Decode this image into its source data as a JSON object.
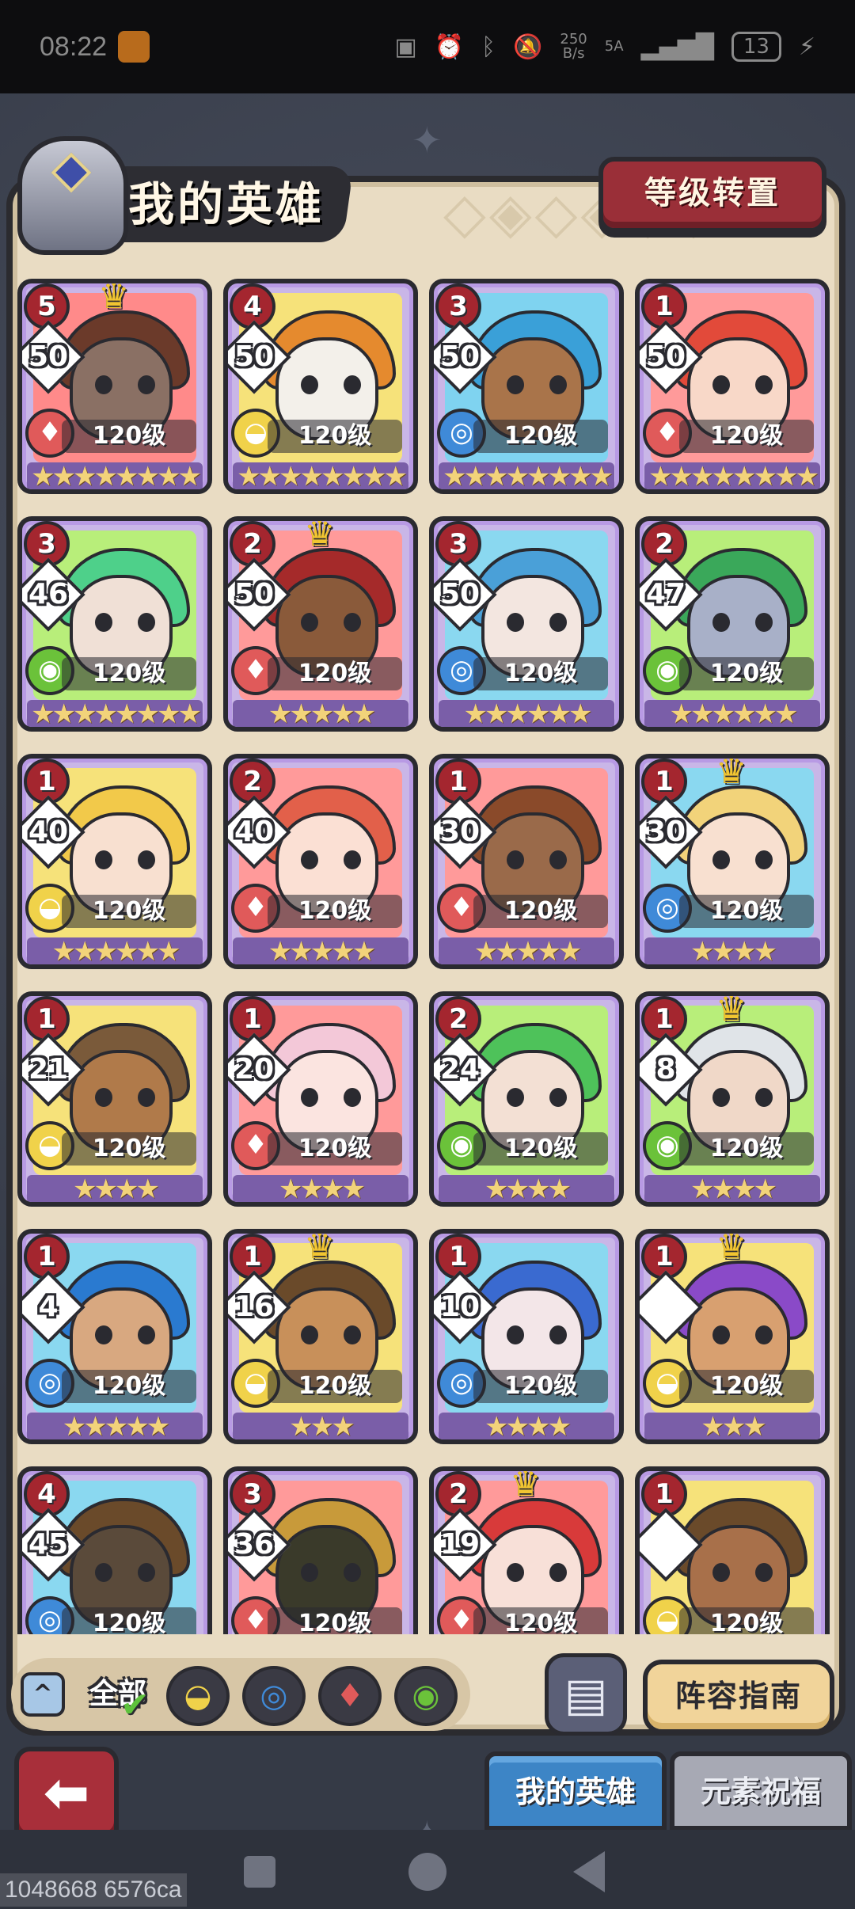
{
  "status_bar": {
    "time": "08:22",
    "speed_value": "250",
    "speed_unit": "B/s",
    "signal": "5A",
    "battery": "13"
  },
  "header": {
    "title": "我的英雄",
    "level_transfer_label": "等级转置"
  },
  "elements": {
    "earth": {
      "glyph": "◒",
      "color": "#f0d24a"
    },
    "water": {
      "glyph": "◎",
      "color": "#3f8ad8"
    },
    "fire": {
      "glyph": "♦",
      "color": "#e05a5a"
    },
    "wind": {
      "glyph": "◉",
      "color": "#6bc23a"
    }
  },
  "heroes": [
    {
      "stars_badge": "5",
      "crown": true,
      "rank": "50",
      "element": "fire",
      "level": "120级",
      "stars": "★★★★★★★★",
      "bg": "#ff8a8a",
      "hair": "#6b3a2a",
      "skin": "#8a7064"
    },
    {
      "stars_badge": "4",
      "crown": false,
      "rank": "50",
      "element": "earth",
      "level": "120级",
      "stars": "★★★★★★★★",
      "bg": "#f6e27a",
      "hair": "#e58a2e",
      "skin": "#f3f0ea"
    },
    {
      "stars_badge": "3",
      "crown": false,
      "rank": "50",
      "element": "water",
      "level": "120级",
      "stars": "★★★★★★★★",
      "bg": "#7fd3f0",
      "hair": "#3aa0d8",
      "skin": "#a9744a"
    },
    {
      "stars_badge": "1",
      "crown": false,
      "rank": "50",
      "element": "fire",
      "level": "120级",
      "stars": "★★★★★★★★",
      "bg": "#ff9a9a",
      "hair": "#e24a3a",
      "skin": "#f8d8c8"
    },
    {
      "stars_badge": "3",
      "crown": false,
      "rank": "46",
      "element": "wind",
      "level": "120级",
      "stars": "★★★★★★★★",
      "bg": "#b8ee7a",
      "hair": "#4ed08a",
      "skin": "#f0e0d6"
    },
    {
      "stars_badge": "2",
      "crown": true,
      "rank": "50",
      "element": "fire",
      "level": "120级",
      "stars": "★★★★★",
      "bg": "#ff9a9a",
      "hair": "#a52a2a",
      "skin": "#8a5a3a"
    },
    {
      "stars_badge": "3",
      "crown": false,
      "rank": "50",
      "element": "water",
      "level": "120级",
      "stars": "★★★★★★",
      "bg": "#8ad8f0",
      "hair": "#4aa0d8",
      "skin": "#f3e6e0"
    },
    {
      "stars_badge": "2",
      "crown": false,
      "rank": "47",
      "element": "wind",
      "level": "120级",
      "stars": "★★★★★★",
      "bg": "#b8ee7a",
      "hair": "#3aa85a",
      "skin": "#a8b0c8"
    },
    {
      "stars_badge": "1",
      "crown": false,
      "rank": "40",
      "element": "earth",
      "level": "120级",
      "stars": "★★★★★★",
      "bg": "#f6e27a",
      "hair": "#f2c94a",
      "skin": "#f8e0d0"
    },
    {
      "stars_badge": "2",
      "crown": false,
      "rank": "40",
      "element": "fire",
      "level": "120级",
      "stars": "★★★★★",
      "bg": "#ff9a9a",
      "hair": "#e2604a",
      "skin": "#fbe0d4"
    },
    {
      "stars_badge": "1",
      "crown": false,
      "rank": "30",
      "element": "fire",
      "level": "120级",
      "stars": "★★★★★",
      "bg": "#ff9a9a",
      "hair": "#8a4a2a",
      "skin": "#9a6a4a"
    },
    {
      "stars_badge": "1",
      "crown": true,
      "rank": "30",
      "element": "water",
      "level": "120级",
      "stars": "★★★★",
      "bg": "#8ad8f0",
      "hair": "#f2d37a",
      "skin": "#f8e0d0"
    },
    {
      "stars_badge": "1",
      "crown": false,
      "rank": "21",
      "element": "earth",
      "level": "120级",
      "stars": "★★★★",
      "bg": "#f6e27a",
      "hair": "#7a5a3a",
      "skin": "#b07a4a"
    },
    {
      "stars_badge": "1",
      "crown": false,
      "rank": "20",
      "element": "fire",
      "level": "120级",
      "stars": "★★★★",
      "bg": "#ff9a9a",
      "hair": "#f3c8d8",
      "skin": "#fbe4e0"
    },
    {
      "stars_badge": "2",
      "crown": false,
      "rank": "24",
      "element": "wind",
      "level": "120级",
      "stars": "★★★★",
      "bg": "#b8ee7a",
      "hair": "#4ec25a",
      "skin": "#f3e0d4"
    },
    {
      "stars_badge": "1",
      "crown": true,
      "rank": "8",
      "element": "wind",
      "level": "120级",
      "stars": "★★★★",
      "bg": "#b8ee7a",
      "hair": "#e0e4e8",
      "skin": "#f0d8c8"
    },
    {
      "stars_badge": "1",
      "crown": false,
      "rank": "4",
      "element": "water",
      "level": "120级",
      "stars": "★★★★★",
      "bg": "#8ad8f0",
      "hair": "#2a7ad0",
      "skin": "#d8a880"
    },
    {
      "stars_badge": "1",
      "crown": true,
      "rank": "16",
      "element": "earth",
      "level": "120级",
      "stars": "★★★",
      "bg": "#f6e27a",
      "hair": "#6a4a2a",
      "skin": "#c8905a"
    },
    {
      "stars_badge": "1",
      "crown": false,
      "rank": "10",
      "element": "water",
      "level": "120级",
      "stars": "★★★★",
      "bg": "#8ad8f0",
      "hair": "#3a6ad0",
      "skin": "#f3e6e8"
    },
    {
      "stars_badge": "1",
      "crown": true,
      "rank": "",
      "element": "earth",
      "level": "120级",
      "stars": "★★★",
      "bg": "#f6e27a",
      "hair": "#8a4ac8",
      "skin": "#d8a070"
    },
    {
      "stars_badge": "4",
      "crown": false,
      "rank": "45",
      "element": "water",
      "level": "120级",
      "stars": "",
      "bg": "#8ad8f0",
      "hair": "#6a4a2a",
      "skin": "#5a4a3a"
    },
    {
      "stars_badge": "3",
      "crown": false,
      "rank": "36",
      "element": "fire",
      "level": "120级",
      "stars": "",
      "bg": "#ff9a9a",
      "hair": "#c89a3a",
      "skin": "#3a3a2a"
    },
    {
      "stars_badge": "2",
      "crown": true,
      "rank": "19",
      "element": "fire",
      "level": "120级",
      "stars": "",
      "bg": "#ff9a9a",
      "hair": "#d83a3a",
      "skin": "#f8e0d8"
    },
    {
      "stars_badge": "1",
      "crown": false,
      "rank": "",
      "element": "earth",
      "level": "120级",
      "stars": "",
      "bg": "#f6e27a",
      "hair": "#6a4a2a",
      "skin": "#a8704a"
    }
  ],
  "filters": {
    "all_label": "全部"
  },
  "bottom": {
    "guide_label": "阵容指南",
    "tab_my_heroes": "我的英雄",
    "tab_element_blessing": "元素祝福"
  },
  "debug_text": "1048668 6576ca"
}
